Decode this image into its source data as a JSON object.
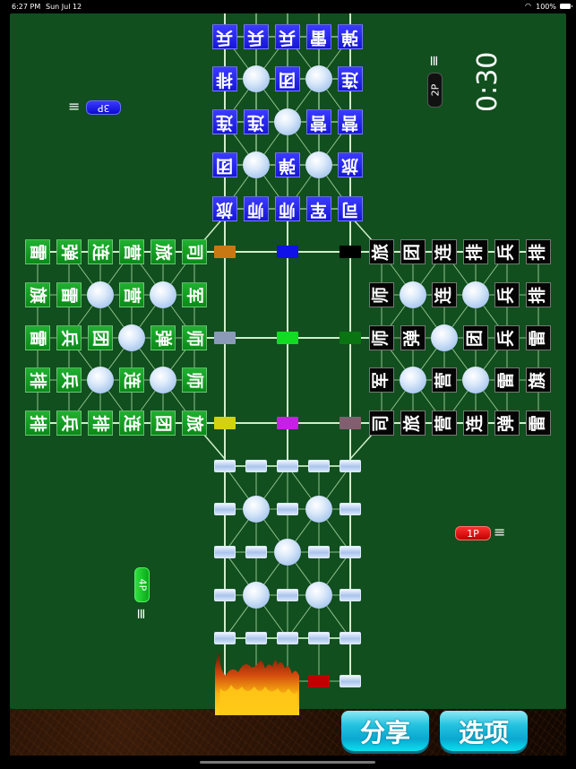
{
  "status_bar": {
    "time": "6:27 PM",
    "date": "Sun Jul 12",
    "battery": "100%",
    "wifi_icon": "wifi-icon"
  },
  "players": {
    "p1": {
      "label": "1P",
      "color": "#e01010"
    },
    "p2": {
      "label": "2P",
      "color": "#111111"
    },
    "p3": {
      "label": "3P",
      "color": "#1a1ae0"
    },
    "p4": {
      "label": "4P",
      "color": "#10b020"
    }
  },
  "timer": "0:30",
  "menu_icon": "≡",
  "top_army": {
    "color": "blue",
    "rows": [
      [
        "兵",
        "兵",
        "兵",
        "雷",
        "弹"
      ],
      [
        "排",
        "",
        "团",
        "",
        "连"
      ],
      [
        "连",
        "连",
        "",
        "营",
        "营"
      ],
      [
        "团",
        "",
        "弹",
        "",
        "旅"
      ],
      [
        "旅",
        "师",
        "师",
        "军",
        "司"
      ]
    ]
  },
  "left_army": {
    "color": "green",
    "rows": [
      [
        "雷",
        "弹",
        "连",
        "营",
        "旅",
        "司"
      ],
      [
        "旗",
        "雷",
        "",
        "营",
        "",
        "军"
      ],
      [
        "雷",
        "兵",
        "团",
        "",
        "弹",
        "师"
      ],
      [
        "排",
        "兵",
        "",
        "连",
        "",
        "师"
      ],
      [
        "排",
        "兵",
        "排",
        "连",
        "团",
        "旅"
      ]
    ]
  },
  "right_army": {
    "color": "black",
    "rows": [
      [
        "旅",
        "团",
        "连",
        "排",
        "兵",
        "排"
      ],
      [
        "师",
        "",
        "连",
        "",
        "兵",
        "排"
      ],
      [
        "师",
        "弹",
        "",
        "团",
        "兵",
        "雷"
      ],
      [
        "军",
        "",
        "营",
        "",
        "雷",
        "旗"
      ],
      [
        "司",
        "旅",
        "营",
        "连",
        "弹",
        "雷"
      ]
    ]
  },
  "center_stations": [
    [
      "#c87812",
      "#1010e8",
      "#000000"
    ],
    [
      "#8a9ab8",
      "#12dc22",
      "#0a7412"
    ],
    [
      "#d2d210",
      "#c81ee8",
      "#806070"
    ]
  ],
  "bottom_marker_color": "#c00000",
  "buttons": {
    "share": "分享",
    "options": "选项"
  }
}
